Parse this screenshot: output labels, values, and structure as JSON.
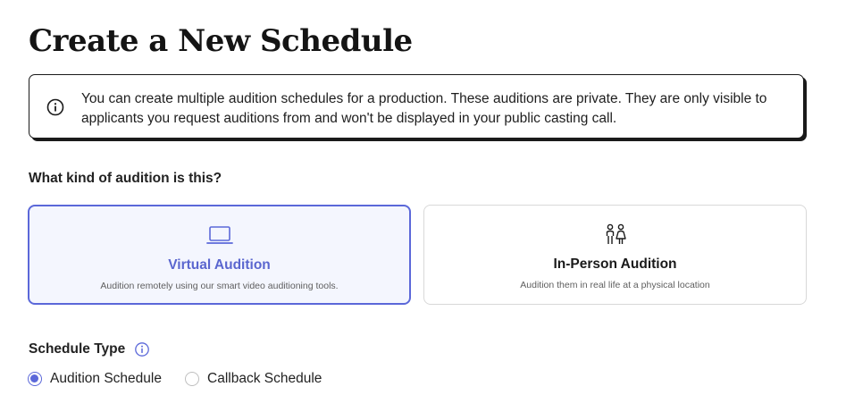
{
  "page": {
    "title": "Create a New Schedule"
  },
  "info_banner": {
    "icon": "info-circle-icon",
    "text": "You can create multiple audition schedules for a production. These auditions are private. They are only visible to applicants you request auditions from and won't be displayed in your public casting call."
  },
  "audition_kind": {
    "question": "What kind of audition is this?",
    "options": [
      {
        "icon": "laptop-icon",
        "title": "Virtual Audition",
        "description": "Audition remotely using our smart video auditioning tools.",
        "selected": true
      },
      {
        "icon": "people-icon",
        "title": "In-Person Audition",
        "description": "Audition them in real life at a physical location",
        "selected": false
      }
    ]
  },
  "schedule_type": {
    "label": "Schedule Type",
    "info_icon": "info-circle-icon",
    "options": [
      {
        "label": "Audition Schedule",
        "selected": true
      },
      {
        "label": "Callback Schedule",
        "selected": false
      }
    ]
  },
  "colors": {
    "accent": "#5b68d9",
    "selected_card_bg": "#f4f6fe",
    "border_dark": "#1a1a1a"
  }
}
